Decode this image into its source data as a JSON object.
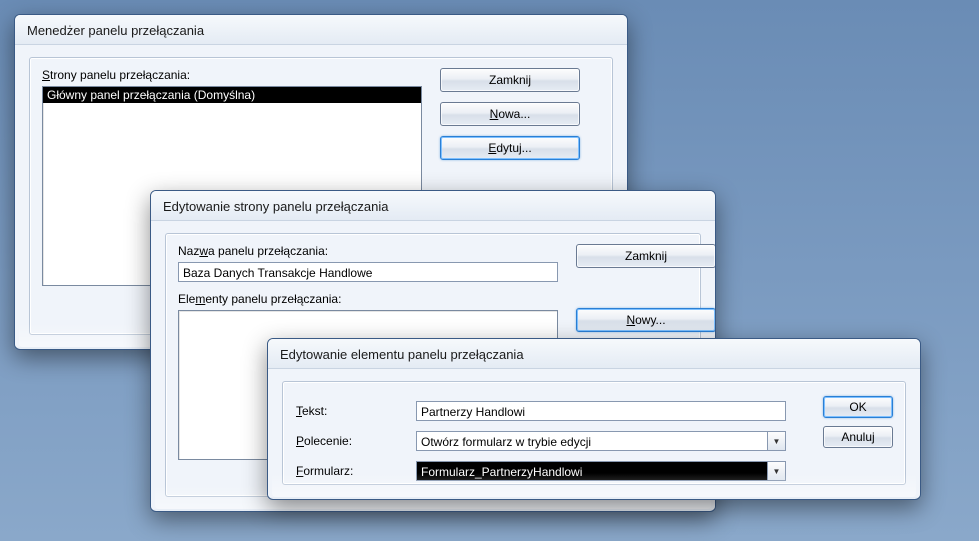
{
  "win1": {
    "title": "Menedżer panelu przełączania",
    "pages_label": "Strony panelu przełączania:",
    "list_item": "Główny panel przełączania (Domyślna)",
    "btn_close": "Zamknij",
    "btn_new": "Nowa...",
    "btn_edit": "Edytuj..."
  },
  "win2": {
    "title": "Edytowanie strony panelu przełączania",
    "name_label": "Nazwa panelu przełączania:",
    "name_value": "Baza Danych Transakcje Handlowe",
    "elements_label": "Elementy panelu przełączania:",
    "btn_close": "Zamknij",
    "btn_new": "Nowy..."
  },
  "win3": {
    "title": "Edytowanie elementu panelu przełączania",
    "text_label": "Tekst:",
    "text_value": "Partnerzy Handlowi",
    "command_label": "Polecenie:",
    "command_value": "Otwórz formularz w trybie edycji",
    "form_label": "Formularz:",
    "form_value": "Formularz_PartnerzyHandlowi",
    "btn_ok": "OK",
    "btn_cancel": "Anuluj"
  }
}
